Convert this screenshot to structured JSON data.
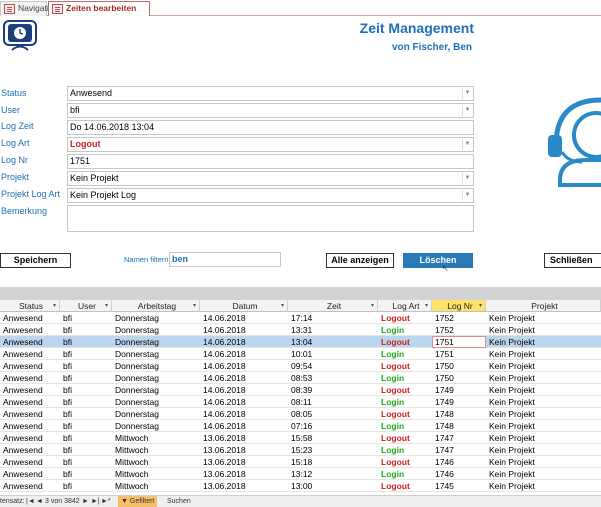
{
  "tabs": [
    {
      "label": "Navigation",
      "active": false
    },
    {
      "label": "Zeiten bearbeiten",
      "active": true
    }
  ],
  "header": {
    "title": "Zeit Management",
    "subtitle": "von Fischer, Ben"
  },
  "form": {
    "status": {
      "label": "Status",
      "value": "Anwesend"
    },
    "user": {
      "label": "User",
      "value": "bfi"
    },
    "logzeit": {
      "label": "Log Zeit",
      "value": "Do 14.06.2018 13:04"
    },
    "logart": {
      "label": "Log Art",
      "value": "Logout"
    },
    "lognr": {
      "label": "Log Nr",
      "value": "1751"
    },
    "projekt": {
      "label": "Projekt",
      "value": "Kein Projekt"
    },
    "projektlogart": {
      "label": "Projekt Log Art",
      "value": "Kein Projekt Log"
    },
    "bemerkung": {
      "label": "Bemerkung",
      "value": ""
    }
  },
  "buttons": {
    "speichern": "Speichern",
    "filter_label": "Namen filtern",
    "filter_value": "ben",
    "alle": "Alle anzeigen",
    "loeschen": "Löschen",
    "schliessen": "Schließen"
  },
  "table": {
    "headers": [
      "Status",
      "User",
      "Arbeitstag",
      "Datum",
      "Zeit",
      "Log Art",
      "Log Nr",
      "Projekt"
    ],
    "rows": [
      [
        "Anwesend",
        "bfi",
        "Donnerstag",
        "14.06.2018",
        "17:14",
        "Logout",
        "1752",
        "Kein Projekt"
      ],
      [
        "Anwesend",
        "bfi",
        "Donnerstag",
        "14.06.2018",
        "13:31",
        "Login",
        "1752",
        "Kein Projekt"
      ],
      [
        "Anwesend",
        "bfi",
        "Donnerstag",
        "14.06.2018",
        "13:04",
        "Logout",
        "1751",
        "Kein Projekt"
      ],
      [
        "Anwesend",
        "bfi",
        "Donnerstag",
        "14.06.2018",
        "10:01",
        "Login",
        "1751",
        "Kein Projekt"
      ],
      [
        "Anwesend",
        "bfi",
        "Donnerstag",
        "14.06.2018",
        "09:54",
        "Logout",
        "1750",
        "Kein Projekt"
      ],
      [
        "Anwesend",
        "bfi",
        "Donnerstag",
        "14.06.2018",
        "08:53",
        "Login",
        "1750",
        "Kein Projekt"
      ],
      [
        "Anwesend",
        "bfi",
        "Donnerstag",
        "14.06.2018",
        "08:39",
        "Logout",
        "1749",
        "Kein Projekt"
      ],
      [
        "Anwesend",
        "bfi",
        "Donnerstag",
        "14.06.2018",
        "08:11",
        "Login",
        "1749",
        "Kein Projekt"
      ],
      [
        "Anwesend",
        "bfi",
        "Donnerstag",
        "14.06.2018",
        "08:05",
        "Logout",
        "1748",
        "Kein Projekt"
      ],
      [
        "Anwesend",
        "bfi",
        "Donnerstag",
        "14.06.2018",
        "07:16",
        "Login",
        "1748",
        "Kein Projekt"
      ],
      [
        "Anwesend",
        "bfi",
        "Mittwoch",
        "13.06.2018",
        "15:58",
        "Logout",
        "1747",
        "Kein Projekt"
      ],
      [
        "Anwesend",
        "bfi",
        "Mittwoch",
        "13.06.2018",
        "15:23",
        "Login",
        "1747",
        "Kein Projekt"
      ],
      [
        "Anwesend",
        "bfi",
        "Mittwoch",
        "13.06.2018",
        "15:18",
        "Logout",
        "1746",
        "Kein Projekt"
      ],
      [
        "Anwesend",
        "bfi",
        "Mittwoch",
        "13.06.2018",
        "13:12",
        "Login",
        "1746",
        "Kein Projekt"
      ],
      [
        "Anwesend",
        "bfi",
        "Mittwoch",
        "13.06.2018",
        "13:00",
        "Logout",
        "1745",
        "Kein Projekt"
      ]
    ],
    "selected_row": 2
  },
  "statusbar": {
    "record_label": "tensatz:",
    "position": "3 von 3842",
    "filter_state": "Gefiltert",
    "search": "Suchen"
  },
  "colors": {
    "accent": "#1e6fb5",
    "logout": "#d02020",
    "login": "#1ea81e",
    "selected": "#bad6ef",
    "header_sel": "#fde26b"
  }
}
